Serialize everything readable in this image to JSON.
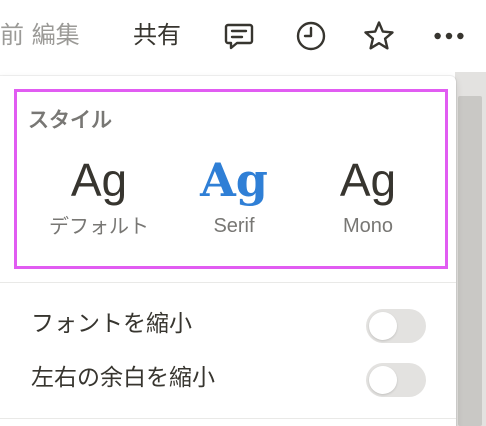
{
  "topbar": {
    "breadcrumb": "前 編集",
    "share_label": "共有",
    "icons": [
      "comment-icon",
      "clock-icon",
      "star-icon",
      "more-icon"
    ]
  },
  "style_section": {
    "title": "スタイル",
    "options": [
      {
        "sample": "Ag",
        "label": "デフォルト"
      },
      {
        "sample": "Ag",
        "label": "Serif",
        "selected": true
      },
      {
        "sample": "Ag",
        "label": "Mono"
      }
    ],
    "highlight_color": "#e15cf2",
    "selected_color": "#2f7fd6"
  },
  "settings": [
    {
      "label": "フォントを縮小",
      "on": false
    },
    {
      "label": "左右の余白を縮小",
      "on": false
    }
  ]
}
